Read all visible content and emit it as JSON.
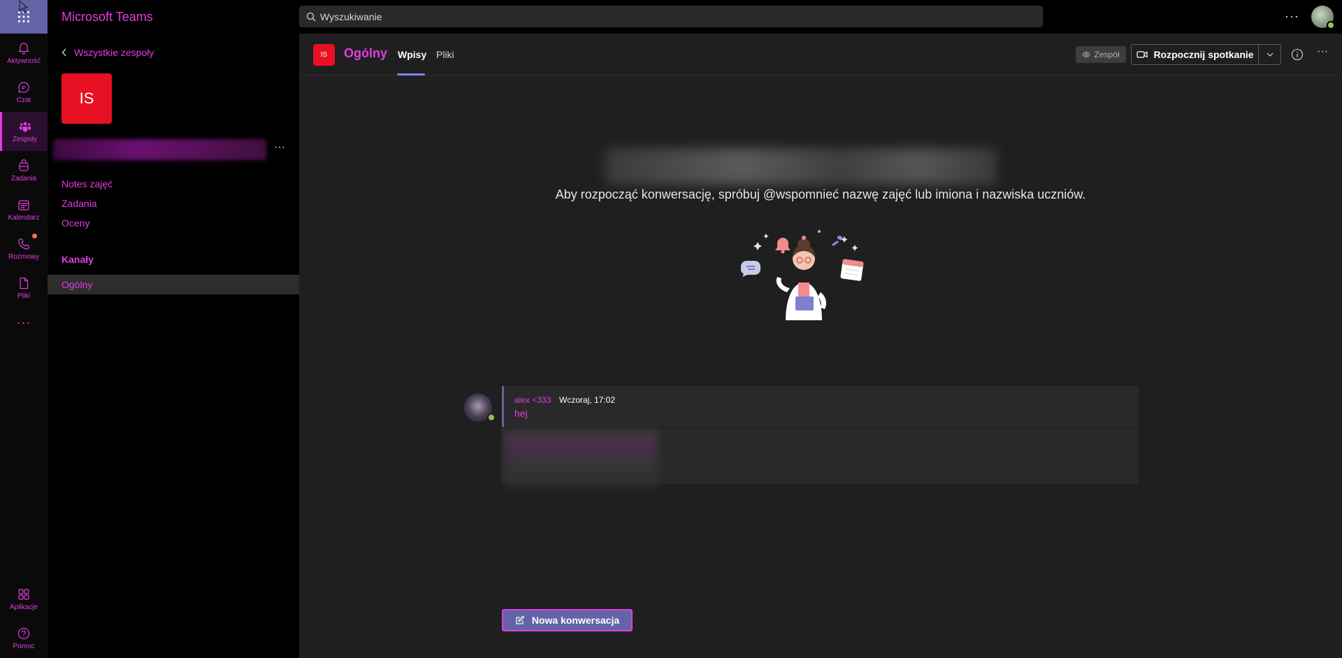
{
  "app": {
    "title": "Microsoft Teams"
  },
  "search": {
    "placeholder": "Wyszukiwanie"
  },
  "rail": {
    "items": [
      {
        "label": "Aktywność",
        "icon": "bell-icon"
      },
      {
        "label": "Czat",
        "icon": "chat-icon"
      },
      {
        "label": "Zespoły",
        "icon": "teams-icon"
      },
      {
        "label": "Zadania",
        "icon": "assignments-icon"
      },
      {
        "label": "Kalendarz",
        "icon": "calendar-icon"
      },
      {
        "label": "Rozmowy",
        "icon": "phone-icon"
      },
      {
        "label": "Pliki",
        "icon": "file-icon"
      }
    ],
    "more": "···",
    "bottom": [
      {
        "label": "Aplikacje",
        "icon": "apps-icon"
      },
      {
        "label": "Pomoc",
        "icon": "help-icon"
      }
    ]
  },
  "panel": {
    "back_label": "Wszystkie zespoły",
    "team_initials": "IS",
    "tabs": [
      "Notes zajęć",
      "Zadania",
      "Oceny"
    ],
    "channels_heading": "Kanały",
    "channels": [
      "Ogólny"
    ]
  },
  "channel": {
    "initials": "IS",
    "title": "Ogólny",
    "tabs": [
      "Wpisy",
      "Pliki"
    ],
    "team_button": "Zespół",
    "meet_button": "Rozpocznij spotkanie"
  },
  "body": {
    "hint": "Aby rozpocząć konwersację, spróbuj @wspomnieć nazwę zajęć lub imiona i nazwiska uczniów."
  },
  "message": {
    "author": "alex <333",
    "time": "Wczoraj, 17:02",
    "text": "hej"
  },
  "new_conversation": "Nowa konwersacja",
  "colors": {
    "accent": "#e03ee0",
    "brand": "#6264a7",
    "team_red": "#e81123",
    "presence": "#92c353"
  }
}
